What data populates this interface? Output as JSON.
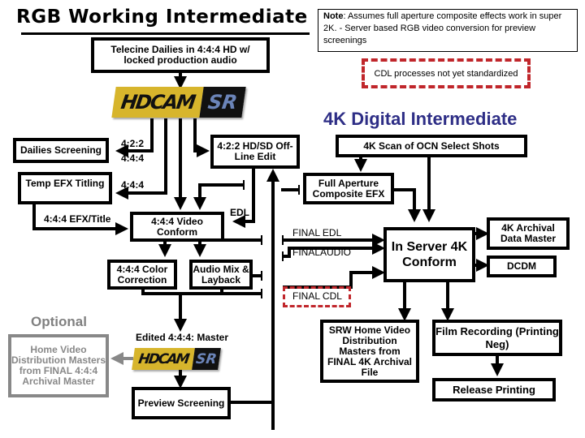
{
  "header": {
    "title": "RGB Working Intermediate",
    "note_bold": "Note",
    "note_text": ": Assumes full aperture composite effects work in super 2K.  - Server based RGB video conversion for preview screenings",
    "cdl_note": "CDL processes not yet standardized",
    "di_title": "4K Digital Intermediate",
    "optional_label": "Optional"
  },
  "colors": {
    "di_title": "#2e2e86",
    "cdl_dashed": "#c0262b",
    "hdcam_gold": "#d7b52c",
    "hdcam_sr": "#6b84b8",
    "optional_gray": "#888888"
  },
  "logos": {
    "hdcam_top": {
      "left_text": "HDCAM",
      "right_text": "SR"
    },
    "hdcam_bottom": {
      "left_text": "HDCAM",
      "right_text": "SR"
    }
  },
  "boxes": {
    "telecine": "Telecine Dailies in 4:4:4 HD w/ locked production audio",
    "dailies_screening": "Dailies Screening",
    "temp_efx": "Temp EFX Titling",
    "offline_edit": "4:2:2 HD/SD Off-Line Edit",
    "video_conform": "4:4:4 Video Conform",
    "color_correction": "4:4:4 Color Correction",
    "audio_mix": "Audio Mix & Layback",
    "scan_4k": "4K Scan of OCN Select Shots",
    "full_aperture": "Full Aperture Composite EFX",
    "server_conform": "In Server 4K Conform",
    "archival_master": "4K Archival Data Master",
    "dcdm": "DCDM",
    "srw_home_video": "SRW Home Video Distribution Masters from FINAL 4K Archival File",
    "film_recording": "Film Recording (Printing Neg)",
    "release_printing": "Release Printing",
    "preview_screening": "Preview Screening",
    "home_video_optional": "Home Video Distribution Masters from FINAL 4:4:4 Archival Master"
  },
  "labels": {
    "l422": "4:2:2",
    "l444a": "4:4:4",
    "l444b": "4:4:4",
    "efx_title": "4:4:4 EFX/Title",
    "edl": "EDL",
    "final_edl": "FINAL EDL",
    "final_audio": "FINALAUDIO",
    "final_cdl": "FINAL CDL",
    "edited_master": "Edited 4:4:4: Master"
  }
}
